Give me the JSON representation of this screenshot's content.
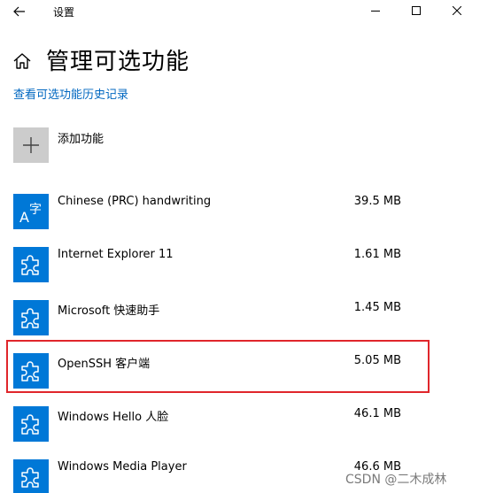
{
  "titlebar": {
    "title": "设置",
    "back_icon": "back-arrow-icon",
    "minimize_icon": "minimize-icon",
    "maximize_icon": "maximize-icon",
    "close_icon": "close-icon"
  },
  "header": {
    "home_icon": "home-icon",
    "page_title": "管理可选功能",
    "history_link": "查看可选功能历史记录"
  },
  "add_feature": {
    "icon": "plus-icon",
    "label": "添加功能"
  },
  "features": [
    {
      "icon": "language-icon",
      "name": "Chinese (PRC) handwriting",
      "size": "39.5 MB"
    },
    {
      "icon": "puzzle-icon",
      "name": "Internet Explorer 11",
      "size": "1.61 MB"
    },
    {
      "icon": "puzzle-icon",
      "name": "Microsoft 快速助手",
      "size": "1.45 MB"
    },
    {
      "icon": "puzzle-icon",
      "name": "OpenSSH 客户端",
      "size": "5.05 MB"
    },
    {
      "icon": "puzzle-icon",
      "name": "Windows Hello 人脸",
      "size": "46.1 MB"
    },
    {
      "icon": "puzzle-icon",
      "name": "Windows Media Player",
      "size": "46.6 MB"
    }
  ],
  "colors": {
    "accent": "#0078d7",
    "link": "#0067c0",
    "highlight": "#e0262b",
    "add_tile": "#cccccc"
  },
  "watermark": "CSDN @二木成林"
}
